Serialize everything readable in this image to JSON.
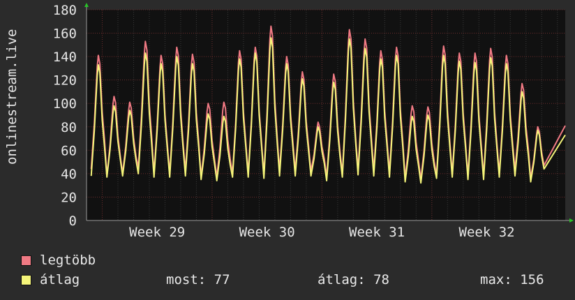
{
  "chart_data": {
    "type": "line",
    "ylabel": "onlinestream.live",
    "ylim": [
      0,
      180
    ],
    "y_ticks": [
      0,
      20,
      40,
      60,
      80,
      100,
      120,
      140,
      160,
      180
    ],
    "x_ticks": [
      "Week 29",
      "Week 30",
      "Week 31",
      "Week 32"
    ],
    "x_range_days": [
      0,
      30.5
    ],
    "x_tick_days": [
      4.5,
      11.5,
      18.5,
      25.5
    ],
    "series": [
      {
        "name": "legtöbb",
        "color": "#f07a84",
        "daily_peaks": [
          141,
          106,
          101,
          153,
          141,
          148,
          142,
          100,
          101,
          145,
          148,
          166,
          140,
          127,
          84,
          125,
          163,
          155,
          145,
          148,
          98,
          97,
          149,
          143,
          143,
          147,
          141,
          117,
          80
        ],
        "daily_troughs": [
          44,
          38,
          40,
          45,
          40,
          40,
          42,
          37,
          37,
          40,
          40,
          39,
          42,
          42,
          42,
          37,
          40,
          43,
          42,
          41,
          36,
          35,
          39,
          40,
          38,
          38,
          40,
          43,
          36
        ]
      },
      {
        "name": "átlag",
        "color": "#f5f57a",
        "daily_peaks": [
          133,
          98,
          94,
          143,
          134,
          140,
          134,
          91,
          89,
          138,
          143,
          156,
          134,
          121,
          80,
          118,
          155,
          147,
          138,
          141,
          89,
          90,
          141,
          136,
          135,
          139,
          134,
          110,
          77
        ],
        "daily_troughs": [
          38,
          37,
          38,
          40,
          37,
          37,
          38,
          35,
          34,
          37,
          37,
          36,
          38,
          38,
          38,
          34,
          37,
          39,
          38,
          37,
          33,
          32,
          36,
          37,
          35,
          35,
          37,
          38,
          33
        ]
      }
    ],
    "grid": true,
    "legend": "bottom-left"
  },
  "legend": {
    "item1": "legtöbb",
    "item2": "átlag"
  },
  "stats": {
    "now": "most: 77",
    "avg": "átlag: 78",
    "max": "max: 156"
  },
  "colors": {
    "background": "#2b2b2b",
    "plot_bg": "#111111",
    "grid": "#3a3a3a",
    "grid_major": "#6b2b2b",
    "axis_arrow": "#27c427"
  }
}
